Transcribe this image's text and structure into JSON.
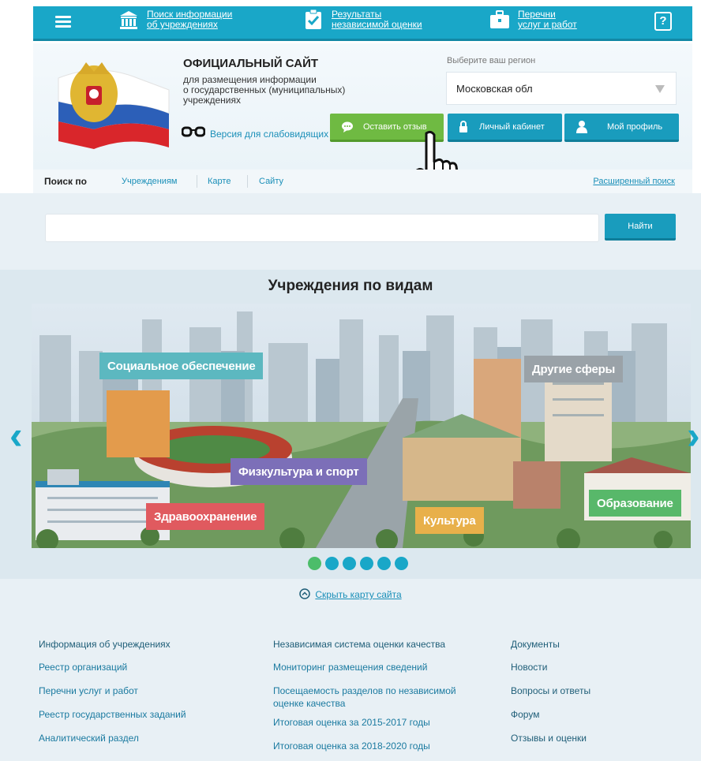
{
  "topnav": {
    "items": [
      {
        "label_l1": "Поиск информации",
        "label_l2": "об учреждениях",
        "icon": "building-columns-icon"
      },
      {
        "label_l1": "Результаты",
        "label_l2": "независимой оценки",
        "icon": "clipboard-check-icon"
      },
      {
        "label_l1": "Перечни",
        "label_l2": "услуг и работ",
        "icon": "briefcase-icon"
      }
    ],
    "help_label": "?"
  },
  "header": {
    "title": "ОФИЦИАЛЬНЫЙ САЙТ",
    "subtitle_l1": "для размещения информации",
    "subtitle_l2": "о государственных (муниципальных)",
    "subtitle_l3": "учреждениях",
    "lowvision_label": "Версия для слабовидящих",
    "region_label": "Выберите ваш регион",
    "region_value": "Московская обл",
    "feedback_label": "Оставить отзыв",
    "cabinet_label": "Личный кабинет",
    "profile_label": "Мой профиль"
  },
  "searchby": {
    "label": "Поиск по",
    "options": [
      "Учреждениям",
      "Карте",
      "Сайту"
    ],
    "advanced": "Расширенный поиск"
  },
  "search": {
    "placeholder": "",
    "button": "Найти"
  },
  "carousel": {
    "title": "Учреждения по видам",
    "categories": [
      {
        "label": "Социальное обеспечение",
        "color": "#5cb8c0"
      },
      {
        "label": "Другие сферы",
        "color": "#9aa2a8"
      },
      {
        "label": "Физкультура и спорт",
        "color": "#7c6fb8"
      },
      {
        "label": "Здравоохранение",
        "color": "#e05a5f"
      },
      {
        "label": "Культура",
        "color": "#e8b04a"
      },
      {
        "label": "Образование",
        "color": "#58b86a"
      }
    ],
    "dots_count": 6,
    "active_dot": 1
  },
  "sitemap": {
    "toggle": "Скрыть карту сайта",
    "col1": {
      "head": "Информация об учреждениях",
      "links": [
        "Реестр организаций",
        "Перечни услуг и работ",
        "Реестр государственных заданий",
        "Аналитический раздел"
      ]
    },
    "col2": {
      "head": "Независимая система оценки качества",
      "links": [
        "Мониторинг размещения сведений",
        "Посещаемость разделов по независимой оценке качества",
        "Итоговая оценка за 2015-2017 годы",
        "Итоговая оценка за 2018-2020 годы"
      ]
    },
    "col3": {
      "head": "Документы",
      "links": [
        "Новости",
        "Вопросы и ответы",
        "Форум",
        "Отзывы и оценки"
      ]
    }
  },
  "colors": {
    "primary": "#19a7c8",
    "green": "#6fba42",
    "link": "#1a8fb8"
  }
}
